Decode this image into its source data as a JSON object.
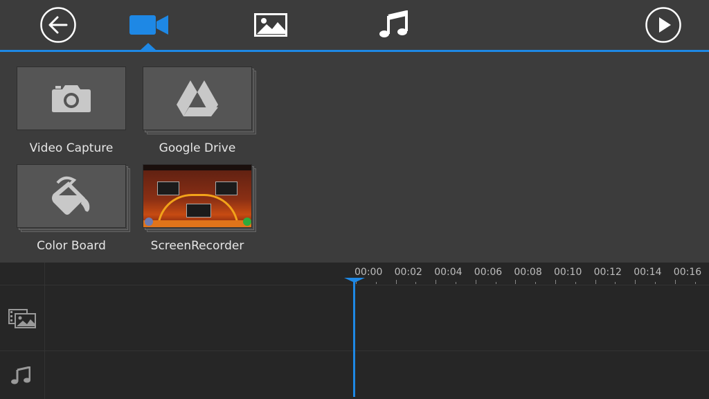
{
  "toolbar": {
    "back_icon": "back-arrow-icon",
    "tabs": [
      {
        "name": "video",
        "icon": "video-camera-icon",
        "active": true
      },
      {
        "name": "photo",
        "icon": "image-icon",
        "active": false
      },
      {
        "name": "music",
        "icon": "music-note-icon",
        "active": false
      }
    ],
    "play_icon": "play-icon",
    "accent_color": "#1e88e5",
    "inactive_color": "#ffffff"
  },
  "sources": {
    "items": [
      {
        "label": "Video Capture",
        "icon": "camera-icon"
      },
      {
        "label": "Google Drive",
        "icon": "google-drive-icon"
      },
      {
        "label": "Color Board",
        "icon": "paint-bucket-icon"
      },
      {
        "label": "ScreenRecorder",
        "icon": "folder-thumbnail"
      }
    ]
  },
  "timeline": {
    "ruler_labels": [
      "00:00",
      "00:02",
      "00:04",
      "00:06",
      "00:08",
      "00:10",
      "00:12",
      "00:14",
      "00:16"
    ],
    "playhead_time": "00:00",
    "tracks": [
      {
        "name": "video-track",
        "icon": "film-image-icon"
      },
      {
        "name": "audio-track",
        "icon": "music-note-icon"
      }
    ]
  }
}
